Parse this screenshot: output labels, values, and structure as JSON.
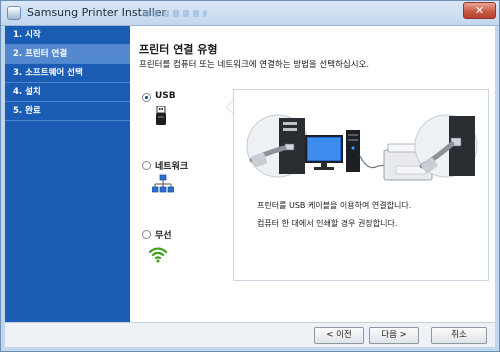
{
  "window": {
    "title": "Samsung Printer Installer",
    "close_label": "✕"
  },
  "sidebar": {
    "steps": [
      {
        "label": "1. 시작",
        "active": false
      },
      {
        "label": "2. 프린터 연결",
        "active": true
      },
      {
        "label": "3. 소프트웨어 선택",
        "active": false
      },
      {
        "label": "4. 설치",
        "active": false
      },
      {
        "label": "5. 완료",
        "active": false
      }
    ]
  },
  "main": {
    "heading": "프린터 연결 유형",
    "instruction": "프린터를 컴퓨터 또는 네트워크에 연결하는 방법을 선택하십시오.",
    "options": [
      {
        "label": "USB",
        "icon": "usb-icon",
        "selected": true
      },
      {
        "label": "네트워크",
        "icon": "network-icon",
        "selected": false
      },
      {
        "label": "무선",
        "icon": "wireless-icon",
        "selected": false
      }
    ],
    "detail": {
      "line1": "프린터를 USB 케이블을 이용하여 연결합니다.",
      "line2": "컴퓨터 한 대에서 인쇄할 경우 권장합니다."
    }
  },
  "footer": {
    "prev_label": "< 이전",
    "next_label": "다음 >",
    "cancel_label": "취소"
  },
  "colors": {
    "sidebar_bg": "#1b5db5",
    "sidebar_active": "#5488cf",
    "wireless_green": "#3fa11b"
  }
}
